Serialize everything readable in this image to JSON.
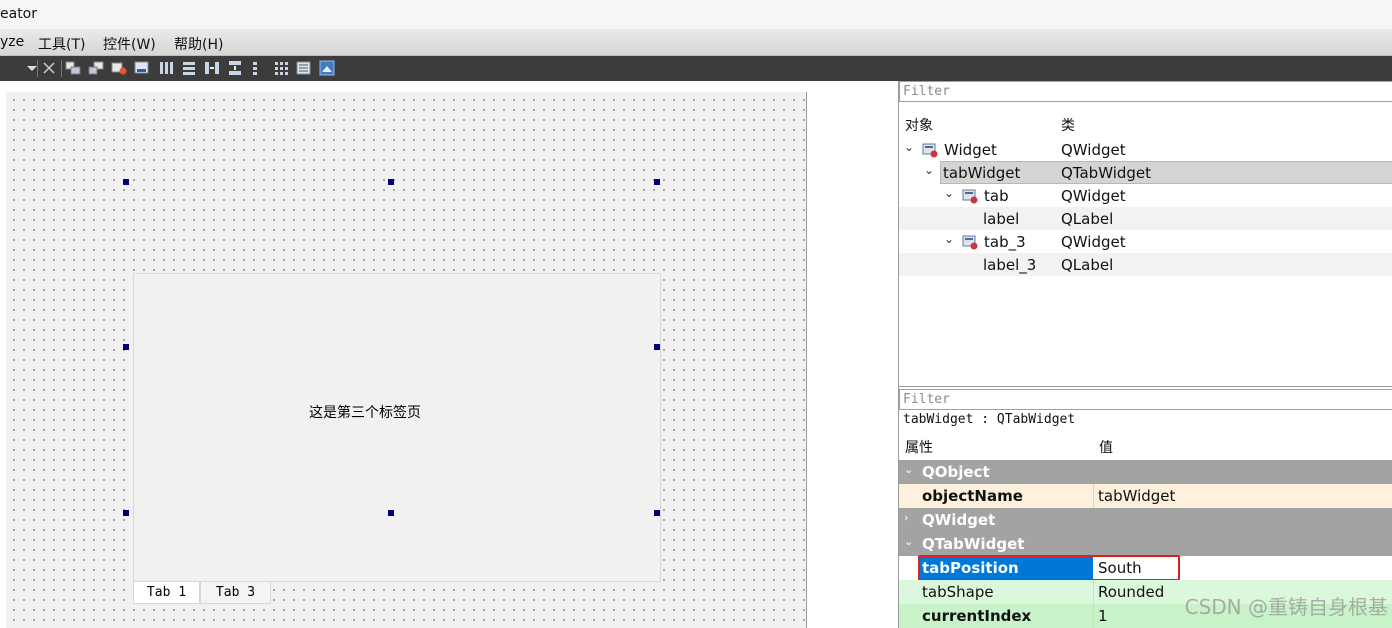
{
  "titlebar": {
    "title": "eator"
  },
  "menubar": {
    "items": [
      {
        "label": "yze"
      },
      {
        "label": "工具(T)"
      },
      {
        "label": "控件(W)"
      },
      {
        "label": "帮助(H)"
      }
    ]
  },
  "toolbar": {
    "icons": [
      "dropdown-arrow-icon",
      "break-layout-icon",
      "raise-icon",
      "lower-icon",
      "edit-tab-order-icon",
      "edit-buddies-icon",
      "layout-horizontal-icon",
      "layout-vertical-icon",
      "layout-splitter-h-icon",
      "layout-splitter-v-icon",
      "layout-grid-icon",
      "layout-form-icon",
      "adjust-size-icon",
      "preview-icon"
    ]
  },
  "form": {
    "tab_content_label": "这是第三个标签页",
    "tabs": [
      {
        "label": "Tab 1",
        "selected": false
      },
      {
        "label": "Tab 3",
        "selected": true
      }
    ],
    "tab_position": "South"
  },
  "object_inspector": {
    "filter_placeholder": "Filter",
    "columns": {
      "object": "对象",
      "class": "类"
    },
    "rows": [
      {
        "name": "Widget",
        "class": "QWidget",
        "level": 0,
        "expanded": true,
        "has_icon": true,
        "selected": false
      },
      {
        "name": "tabWidget",
        "class": "QTabWidget",
        "level": 1,
        "expanded": true,
        "has_icon": false,
        "selected": true
      },
      {
        "name": "tab",
        "class": "QWidget",
        "level": 2,
        "expanded": true,
        "has_icon": true,
        "selected": false
      },
      {
        "name": "label",
        "class": "QLabel",
        "level": 3,
        "expanded": false,
        "has_icon": false,
        "selected": false
      },
      {
        "name": "tab_3",
        "class": "QWidget",
        "level": 2,
        "expanded": true,
        "has_icon": true,
        "selected": false
      },
      {
        "name": "label_3",
        "class": "QLabel",
        "level": 3,
        "expanded": false,
        "has_icon": false,
        "selected": false
      }
    ]
  },
  "property_editor": {
    "filter_placeholder": "Filter",
    "context": "tabWidget : QTabWidget",
    "columns": {
      "property": "属性",
      "value": "值"
    },
    "rows": [
      {
        "type": "group",
        "name": "QObject",
        "expanded": true
      },
      {
        "type": "prop",
        "name": "objectName",
        "value": "tabWidget",
        "bold": true,
        "bg": "#fdf0dc"
      },
      {
        "type": "group",
        "name": "QWidget",
        "expanded": false
      },
      {
        "type": "group",
        "name": "QTabWidget",
        "expanded": true
      },
      {
        "type": "prop",
        "name": "tabPosition",
        "value": "South",
        "bold": true,
        "selected": true,
        "highlighted": true,
        "bg": "#ffffff"
      },
      {
        "type": "prop",
        "name": "tabShape",
        "value": "Rounded",
        "bold": false,
        "bg": "#dcf8dc"
      },
      {
        "type": "prop",
        "name": "currentIndex",
        "value": "1",
        "bold": true,
        "bg": "#c8f3c8"
      }
    ]
  },
  "colors": {
    "selection_blue": "#0078d7",
    "highlight_red": "#e02020",
    "group_gray": "#a3a3a3",
    "handle_navy": "#00007a"
  },
  "watermark": "CSDN @重铸自身根基"
}
